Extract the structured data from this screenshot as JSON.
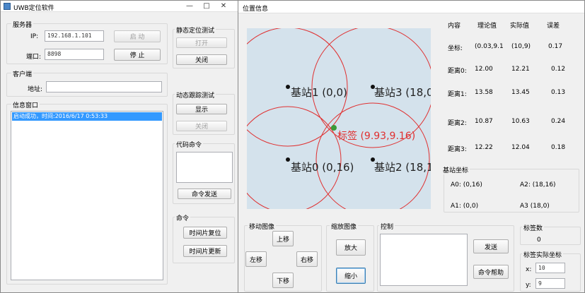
{
  "left_window": {
    "title": "UWB定位软件",
    "caption": {
      "minimize": "—",
      "maximize": "□",
      "close": "✕"
    },
    "server_group": {
      "title": "服务器",
      "ip_label": "IP:",
      "ip_value": "192.168.1.101",
      "port_label": "端口:",
      "port_value": "8898",
      "start_button": "启  动",
      "stop_button": "停  止"
    },
    "client_group": {
      "title": "客户端",
      "address_label": "地址:",
      "address_value": ""
    },
    "message_group": {
      "title": "信息窗口",
      "items": [
        "启动成功，时间:2016/6/17 0:53:33"
      ]
    },
    "static_group": {
      "title": "静态定位测试",
      "open_button": "打开",
      "close_button": "关闭"
    },
    "dynamic_group": {
      "title": "动态跟踪测试",
      "show_button": "显示",
      "hide_button": "关闭"
    },
    "code_group": {
      "title": "代码命令",
      "send_button": "命令发送"
    },
    "command_group": {
      "title": "命令",
      "timeslot_reset_button": "时间片复位",
      "timeslot_update_button": "时间片更新"
    }
  },
  "right_window": {
    "title": "位置信息",
    "plot": {
      "stations": [
        {
          "label": "基站1 (0,0)"
        },
        {
          "label": "基站3 (18,0"
        },
        {
          "label": "基站0 (0,16)"
        },
        {
          "label": "基站2 (18,1"
        }
      ],
      "tag_label": "标签 (9.93,9.16)",
      "circle_color": "#e03030",
      "tag_color": "#3a9a3a"
    },
    "table": {
      "headers": [
        "内容",
        "理论值",
        "实际值",
        "误差"
      ],
      "rows": [
        [
          "坐标:",
          "(0.03,9.1",
          "(10,9)",
          "0.17"
        ],
        [
          "距离0:",
          "12.00",
          "12.21",
          "0.12"
        ],
        [
          "距离1:",
          "13.58",
          "13.45",
          "0.13"
        ],
        [
          "距离2:",
          "10.87",
          "10.63",
          "0.24"
        ],
        [
          "距离3:",
          "12.22",
          "12.04",
          "0.18"
        ]
      ]
    },
    "anchor_group": {
      "title": "基站坐标",
      "a0": "A0:  (0,16)",
      "a2": "A2:  (18,16)",
      "a1": "A1:  (0,0)",
      "a3": "A3   (18,0)"
    },
    "move_group": {
      "title": "移动图像",
      "up": "上移",
      "left": "左移",
      "right": "右移",
      "down": "下移"
    },
    "zoom_group": {
      "title": "缩放图像",
      "zoom_in": "放大",
      "zoom_out": "缩小"
    },
    "control_group": {
      "title": "控制",
      "send_button": "发送",
      "help_button": "命令帮助"
    },
    "tag_count_group": {
      "title": "标签数",
      "count": "0"
    },
    "tag_coord_group": {
      "title": "标签实际坐标",
      "x_label": "x:",
      "x_value": "10",
      "y_label": "y:",
      "y_value": "9"
    }
  }
}
